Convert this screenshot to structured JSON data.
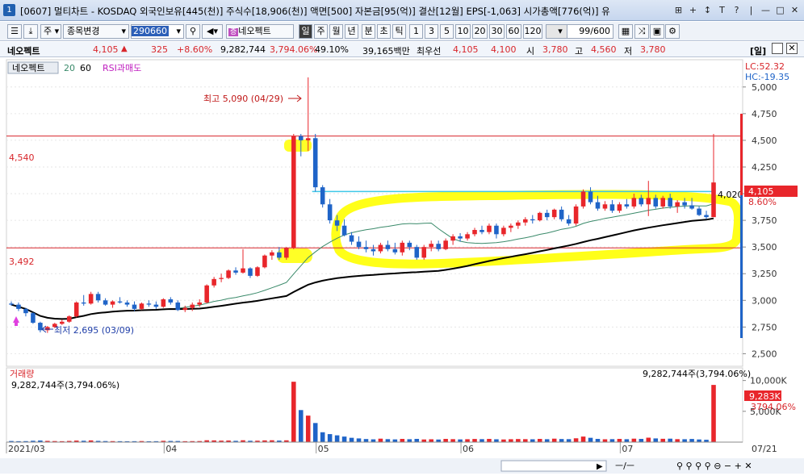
{
  "window": {
    "number": "1",
    "title": "[0607] 멀티차트 - KOSDAQ 외국인보유[445(천)] 주식수[18,906(천)] 액면[500] 자본금[95(억)] 결산[12월] EPS[-1,063] 시가총액[776(억)] 유",
    "buttons": [
      "⊞",
      "+",
      "↕",
      "T",
      "?",
      "|",
      "—",
      "□",
      "✕"
    ]
  },
  "toolbar": {
    "stock_type": "주",
    "search_label": "종목변경",
    "stock_code": "290660",
    "stock_name": "네오펙트",
    "period_active": "일",
    "periods": [
      "주",
      "월",
      "년",
      "분",
      "초",
      "틱"
    ],
    "intervals": [
      "1",
      "3",
      "5",
      "10",
      "20",
      "30",
      "60",
      "120"
    ],
    "count": "99",
    "count_total": "/600"
  },
  "infobar": {
    "name": "네오펙트",
    "price": "4,105",
    "change_arrow": "▲",
    "change": "325",
    "change_pct": "+8.60%",
    "volume": "9,282,744",
    "volume_ratio": "3,794.06%",
    "ratio2": "49.10%",
    "amount": "39,165백만",
    "best_label": "최우선",
    "best_ask": "4,105",
    "best_bid": "4,100",
    "open_label": "시",
    "open": "3,780",
    "high_label": "고",
    "high": "4,560",
    "low_label": "저",
    "low": "3,780",
    "mode": "[일]"
  },
  "price_panel": {
    "legend_name": "네오펙트",
    "ma_labels": [
      "20",
      "60"
    ],
    "indicator": "RSI과매도",
    "lc": "LC:52.32",
    "hc": "HC:-19.35",
    "high_annotation": "최고 5,090 (04/29)",
    "low_annotation": "최저 2,695 (03/09)",
    "hline_upper_label": "4,540",
    "hline_lower_label": "3,492",
    "last_close_label": "4,020",
    "current_price_tag": "4,105",
    "current_pct_tag": "8.60%",
    "axis_ticks": [
      "5,000",
      "4,750",
      "4,500",
      "4,250",
      "4,000",
      "3,750",
      "3,500",
      "3,250",
      "3,000",
      "2,750",
      "2,500"
    ]
  },
  "volume_panel": {
    "label": "거래량",
    "value_left": "9,282,744주(3,794.06%)",
    "value_right": "9,282,744주(3,794.06%)",
    "axis_ticks": [
      "10,000K",
      "5,000K"
    ],
    "tag_value": "9,283K",
    "tag_pct": "3794.06%"
  },
  "x_axis": {
    "labels": [
      "2021/03",
      "04",
      "05",
      "06",
      "07"
    ],
    "end_label": "07/21"
  },
  "colors": {
    "up": "#e8262b",
    "down": "#1f64c8",
    "ma20": "#3a8a6a",
    "ma60": "#000000",
    "highlight": "#ffff00",
    "hline": "#d8262b",
    "cyan_line": "#3fc8e8"
  },
  "chart_data": {
    "type": "candlestick",
    "dates": [
      "03/02",
      "03/03",
      "03/04",
      "03/05",
      "03/08",
      "03/09",
      "03/10",
      "03/11",
      "03/12",
      "03/15",
      "03/16",
      "03/17",
      "03/18",
      "03/19",
      "03/22",
      "03/23",
      "03/24",
      "03/25",
      "03/26",
      "03/29",
      "03/30",
      "03/31",
      "04/01",
      "04/02",
      "04/05",
      "04/06",
      "04/07",
      "04/08",
      "04/09",
      "04/12",
      "04/13",
      "04/14",
      "04/15",
      "04/16",
      "04/19",
      "04/20",
      "04/21",
      "04/22",
      "04/23",
      "04/26",
      "04/27",
      "04/28",
      "04/29",
      "04/30",
      "05/03",
      "05/04",
      "05/06",
      "05/07",
      "05/10",
      "05/11",
      "05/12",
      "05/13",
      "05/14",
      "05/17",
      "05/18",
      "05/20",
      "05/21",
      "05/24",
      "05/25",
      "05/26",
      "05/27",
      "05/28",
      "05/31",
      "06/01",
      "06/02",
      "06/03",
      "06/04",
      "06/07",
      "06/08",
      "06/09",
      "06/10",
      "06/11",
      "06/14",
      "06/15",
      "06/16",
      "06/17",
      "06/18",
      "06/21",
      "06/22",
      "06/23",
      "06/24",
      "06/25",
      "06/28",
      "06/29",
      "06/30",
      "07/01",
      "07/02",
      "07/05",
      "07/06",
      "07/07",
      "07/08",
      "07/09",
      "07/12",
      "07/13",
      "07/14",
      "07/15",
      "07/16",
      "07/19",
      "07/20",
      "07/21"
    ],
    "ohlc": [
      [
        2970,
        2990,
        2950,
        2960
      ],
      [
        2960,
        2980,
        2900,
        2920
      ],
      [
        2920,
        2930,
        2850,
        2880
      ],
      [
        2880,
        2890,
        2780,
        2790
      ],
      [
        2790,
        2800,
        2700,
        2720
      ],
      [
        2720,
        2760,
        2695,
        2750
      ],
      [
        2750,
        2790,
        2740,
        2780
      ],
      [
        2780,
        2820,
        2770,
        2800
      ],
      [
        2800,
        2860,
        2790,
        2850
      ],
      [
        2850,
        2990,
        2840,
        2980
      ],
      [
        2980,
        3050,
        2950,
        2970
      ],
      [
        2970,
        3080,
        2960,
        3060
      ],
      [
        3060,
        3080,
        2980,
        3000
      ],
      [
        3000,
        3020,
        2950,
        2960
      ],
      [
        2960,
        3000,
        2930,
        2990
      ],
      [
        2990,
        3030,
        2970,
        2980
      ],
      [
        2980,
        3000,
        2940,
        2960
      ],
      [
        2960,
        2990,
        2900,
        2920
      ],
      [
        2920,
        2980,
        2910,
        2970
      ],
      [
        2970,
        3000,
        2940,
        2960
      ],
      [
        2960,
        2990,
        2920,
        2940
      ],
      [
        2940,
        3020,
        2930,
        3010
      ],
      [
        3010,
        3030,
        2960,
        2980
      ],
      [
        2980,
        3000,
        2900,
        2910
      ],
      [
        2910,
        2950,
        2890,
        2930
      ],
      [
        2930,
        2980,
        2900,
        2960
      ],
      [
        2960,
        3010,
        2940,
        2980
      ],
      [
        2980,
        3150,
        2970,
        3140
      ],
      [
        3140,
        3220,
        3120,
        3200
      ],
      [
        3200,
        3250,
        3170,
        3210
      ],
      [
        3210,
        3290,
        3200,
        3280
      ],
      [
        3280,
        3310,
        3240,
        3260
      ],
      [
        3260,
        3480,
        3250,
        3300
      ],
      [
        3300,
        3310,
        3210,
        3230
      ],
      [
        3230,
        3320,
        3220,
        3310
      ],
      [
        3310,
        3430,
        3300,
        3420
      ],
      [
        3420,
        3470,
        3380,
        3450
      ],
      [
        3450,
        3500,
        3380,
        3400
      ],
      [
        3400,
        3500,
        3380,
        3490
      ],
      [
        3490,
        4560,
        3480,
        4540
      ],
      [
        4540,
        4560,
        4350,
        4500
      ],
      [
        4500,
        5090,
        4400,
        4520
      ],
      [
        4520,
        4560,
        4020,
        4060
      ],
      [
        4060,
        4080,
        3870,
        3900
      ],
      [
        3900,
        3950,
        3720,
        3750
      ],
      [
        3750,
        3800,
        3650,
        3700
      ],
      [
        3700,
        3760,
        3600,
        3610
      ],
      [
        3610,
        3640,
        3520,
        3550
      ],
      [
        3550,
        3600,
        3480,
        3500
      ],
      [
        3500,
        3560,
        3450,
        3480
      ],
      [
        3480,
        3520,
        3420,
        3460
      ],
      [
        3460,
        3540,
        3440,
        3520
      ],
      [
        3520,
        3560,
        3460,
        3480
      ],
      [
        3480,
        3540,
        3430,
        3450
      ],
      [
        3450,
        3560,
        3420,
        3540
      ],
      [
        3540,
        3560,
        3470,
        3500
      ],
      [
        3500,
        3520,
        3380,
        3400
      ],
      [
        3400,
        3520,
        3380,
        3500
      ],
      [
        3500,
        3560,
        3460,
        3530
      ],
      [
        3530,
        3560,
        3460,
        3480
      ],
      [
        3480,
        3580,
        3470,
        3560
      ],
      [
        3560,
        3620,
        3520,
        3600
      ],
      [
        3600,
        3630,
        3550,
        3580
      ],
      [
        3580,
        3640,
        3560,
        3620
      ],
      [
        3620,
        3680,
        3600,
        3660
      ],
      [
        3660,
        3700,
        3620,
        3640
      ],
      [
        3640,
        3720,
        3620,
        3700
      ],
      [
        3700,
        3720,
        3580,
        3620
      ],
      [
        3620,
        3700,
        3600,
        3680
      ],
      [
        3680,
        3720,
        3640,
        3700
      ],
      [
        3700,
        3750,
        3670,
        3730
      ],
      [
        3730,
        3780,
        3700,
        3760
      ],
      [
        3760,
        3800,
        3720,
        3750
      ],
      [
        3750,
        3830,
        3740,
        3820
      ],
      [
        3820,
        3850,
        3750,
        3780
      ],
      [
        3780,
        3860,
        3760,
        3850
      ],
      [
        3850,
        3880,
        3740,
        3760
      ],
      [
        3760,
        3800,
        3700,
        3720
      ],
      [
        3720,
        3900,
        3700,
        3880
      ],
      [
        3880,
        4040,
        3860,
        4020
      ],
      [
        4020,
        4060,
        3900,
        3920
      ],
      [
        3920,
        3980,
        3840,
        3860
      ],
      [
        3860,
        3930,
        3840,
        3900
      ],
      [
        3900,
        3940,
        3820,
        3840
      ],
      [
        3840,
        3920,
        3820,
        3900
      ],
      [
        3900,
        3950,
        3860,
        3880
      ],
      [
        3880,
        4000,
        3860,
        3960
      ],
      [
        3960,
        3990,
        3880,
        3900
      ],
      [
        3900,
        4120,
        3790,
        3960
      ],
      [
        3960,
        3990,
        3860,
        3880
      ],
      [
        3880,
        3980,
        3860,
        3960
      ],
      [
        3960,
        4000,
        3860,
        3880
      ],
      [
        3880,
        3940,
        3820,
        3920
      ],
      [
        3920,
        3960,
        3860,
        3890
      ],
      [
        3890,
        3960,
        3850,
        3860
      ],
      [
        3860,
        3880,
        3790,
        3800
      ],
      [
        3800,
        3840,
        3760,
        3780
      ],
      [
        3780,
        4560,
        3780,
        4105
      ]
    ],
    "volume_k": [
      180,
      150,
      160,
      220,
      260,
      200,
      170,
      150,
      190,
      250,
      220,
      280,
      200,
      170,
      160,
      150,
      140,
      150,
      170,
      140,
      150,
      210,
      190,
      180,
      150,
      160,
      170,
      300,
      280,
      240,
      260,
      210,
      300,
      220,
      230,
      280,
      300,
      250,
      290,
      9800,
      5200,
      4300,
      3100,
      1600,
      1300,
      1100,
      900,
      700,
      600,
      500,
      450,
      560,
      480,
      440,
      520,
      470,
      520,
      430,
      460,
      420,
      520,
      480,
      440,
      470,
      510,
      480,
      520,
      460,
      430,
      470,
      500,
      480,
      460,
      520,
      470,
      560,
      500,
      480,
      620,
      900,
      700,
      520,
      460,
      480,
      520,
      470,
      560,
      520,
      720,
      600,
      540,
      560,
      480,
      470,
      510,
      430,
      380,
      9283
    ],
    "hlines": [
      4540,
      3492
    ],
    "ylim": [
      2420,
      5180
    ],
    "volume_ylim": [
      0,
      11000
    ]
  }
}
